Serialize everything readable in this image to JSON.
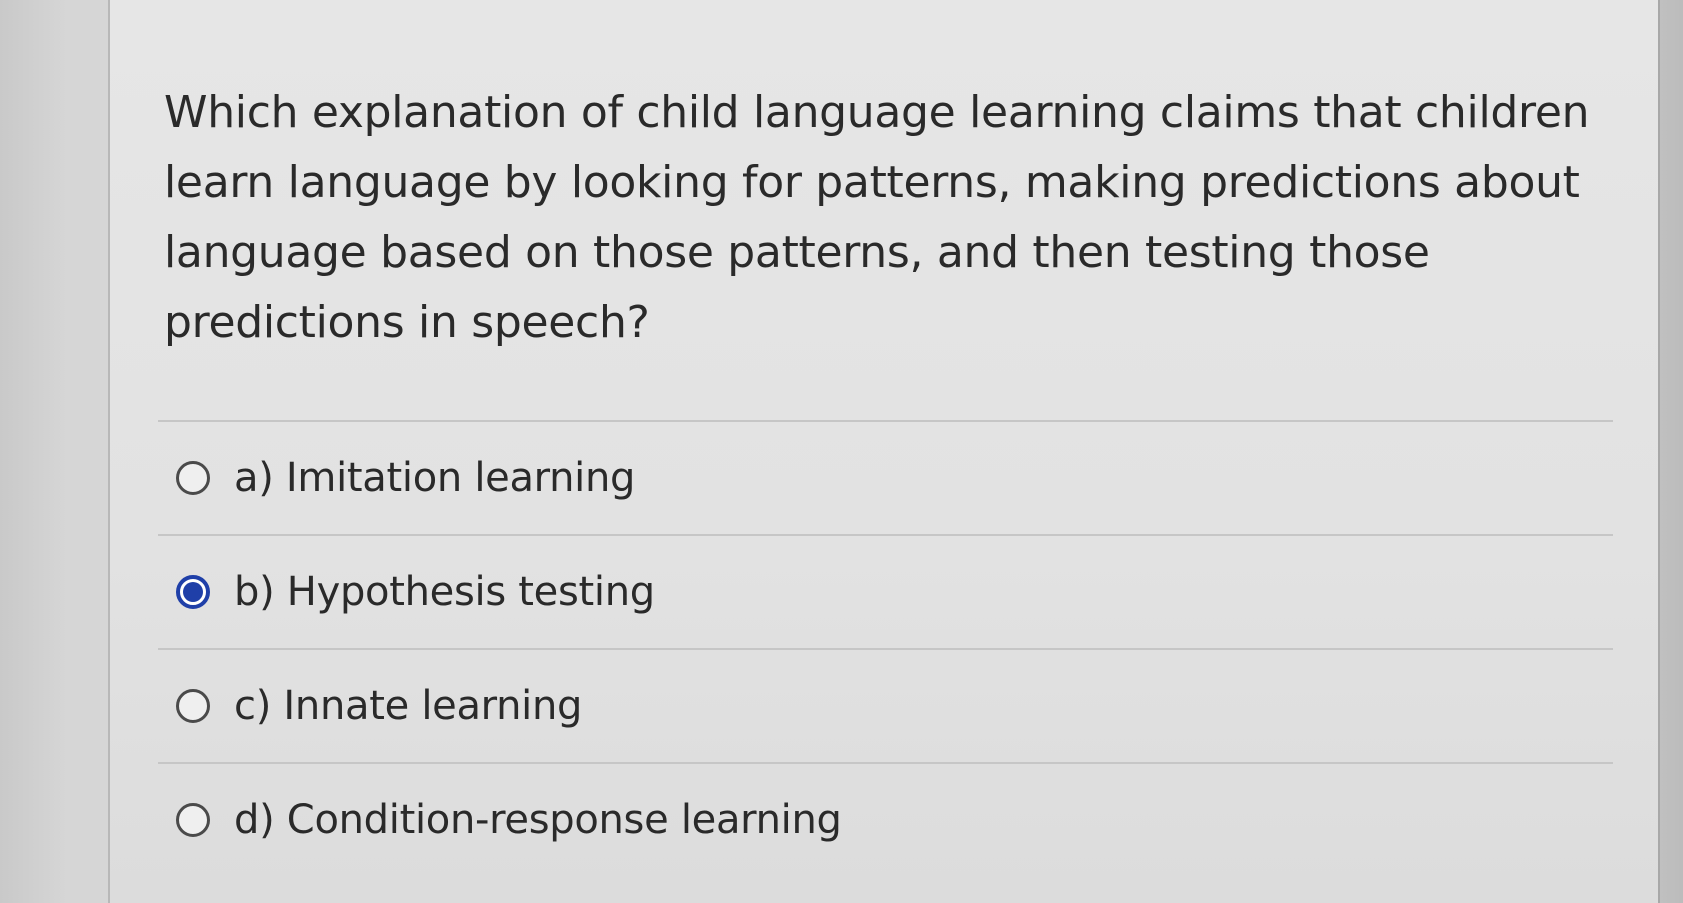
{
  "question": {
    "text": "Which explanation of child language learning claims that children learn language by looking for patterns, making predictions about language based on those patterns, and then testing those predictions in speech?"
  },
  "options": [
    {
      "label": "a) Imitation learning",
      "selected": false
    },
    {
      "label": "b) Hypothesis testing",
      "selected": true
    },
    {
      "label": "c) Innate learning",
      "selected": false
    },
    {
      "label": "d) Condition-response learning",
      "selected": false
    }
  ],
  "colors": {
    "selected_radio": "#1f3fa8",
    "text": "#2a2a2a",
    "divider": "#c6c6c6"
  },
  "icons": {
    "unselected": "radio-unchecked-icon",
    "selected": "radio-checked-icon"
  }
}
